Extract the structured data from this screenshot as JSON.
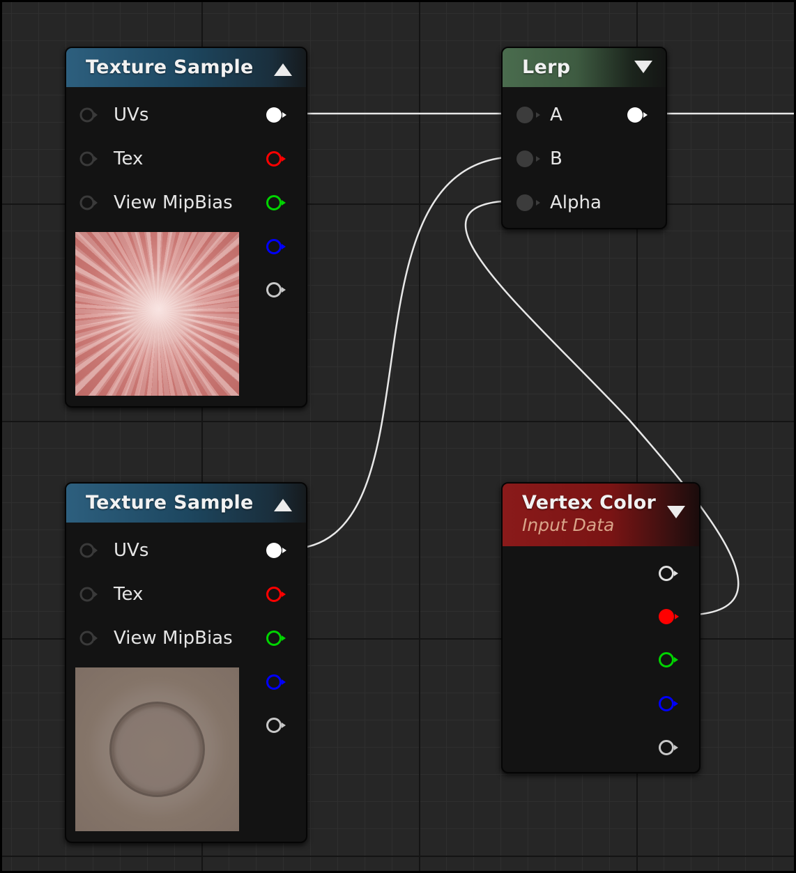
{
  "nodes": {
    "texture_sample_1": {
      "title": "Texture Sample",
      "inputs": [
        "UVs",
        "Tex",
        "View MipBias"
      ],
      "outputs": [
        "white",
        "red",
        "green",
        "blue",
        "gray"
      ],
      "preview": "red-texture-preview"
    },
    "texture_sample_2": {
      "title": "Texture Sample",
      "inputs": [
        "UVs",
        "Tex",
        "View MipBias"
      ],
      "outputs": [
        "white",
        "red",
        "green",
        "blue",
        "gray"
      ],
      "preview": "stone-texture-preview"
    },
    "lerp": {
      "title": "Lerp",
      "inputs": [
        "A",
        "B",
        "Alpha"
      ],
      "outputs": [
        "white"
      ]
    },
    "vertex_color": {
      "title": "Vertex Color",
      "subtitle": "Input Data",
      "outputs": [
        "white",
        "red",
        "green",
        "blue",
        "gray"
      ]
    }
  },
  "connections": [
    {
      "from": "texture_sample_1.output.white",
      "to": "lerp.input.A"
    },
    {
      "from": "texture_sample_2.output.white",
      "to": "lerp.input.B"
    },
    {
      "from": "vertex_color.output.red",
      "to": "lerp.input.Alpha"
    },
    {
      "from": "lerp.output.white",
      "to": "offscreen"
    }
  ],
  "colors": {
    "white": "#ffffff",
    "red": "#ff0000",
    "green": "#00d400",
    "blue": "#0000ff",
    "gray": "#c8c8c8",
    "grid_background": "#262626",
    "texture_header": "#1d4760",
    "lerp_header": "#3e5b41",
    "vertex_color_header": "#7a1414"
  },
  "icons": {
    "collapse": "caret-up-icon",
    "expand": "caret-down-icon"
  }
}
